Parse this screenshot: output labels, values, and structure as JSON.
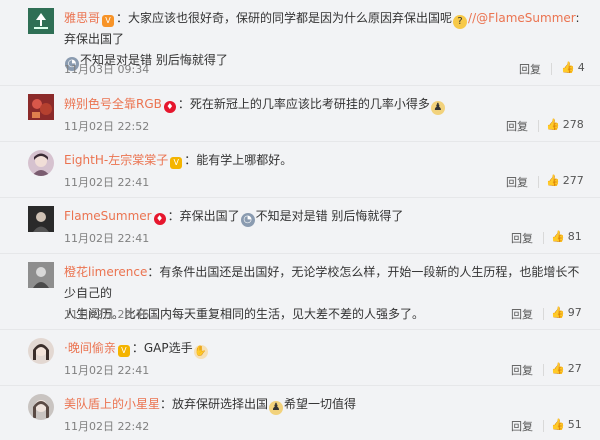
{
  "actions": {
    "reply": "回复",
    "like_icon": "thumb-up-icon"
  },
  "comments": [
    {
      "user": "雅思哥",
      "text": "：大家应该也很好奇，保研的同学都是因为什么原因弃保出国呢",
      "mention": "//@FlameSummer",
      "text2": ":弃保出国了",
      "text3": "不知是对是错 别后悔就得了",
      "time": "11月03日 09:34",
      "likes": "4"
    },
    {
      "user": "辨别色号全靠RGB",
      "text": "：死在新冠上的几率应该比考研挂的几率小得多",
      "time": "11月02日 22:52",
      "likes": "278"
    },
    {
      "user": "EightH-左宗棠棠子",
      "text": "：能有学上哪都好。",
      "time": "11月02日 22:41",
      "likes": "277"
    },
    {
      "user": "FlameSummer",
      "text": "：弃保出国了",
      "text2": "不知是对是错 别后悔就得了",
      "time": "11月02日 22:41",
      "likes": "81"
    },
    {
      "user": "橙花limerence",
      "text": "：有条件出国还是出国好，无论学校怎么样，开始一段新的人生历程，也能增长不少自己的",
      "text2": "人生阅历。比在国内每天重复相同的生活，见大差不差的人强多了。",
      "time": "11月02日 22:46",
      "likes": "97"
    },
    {
      "user": "·晚间偷亲",
      "text": "：GAP选手",
      "time": "11月02日 22:41",
      "likes": "27"
    },
    {
      "user": "美队盾上的小星星",
      "text": "：放弃保研选择出国",
      "text2": "希望一切值得",
      "time": "11月02日 22:42",
      "likes": "51"
    }
  ]
}
